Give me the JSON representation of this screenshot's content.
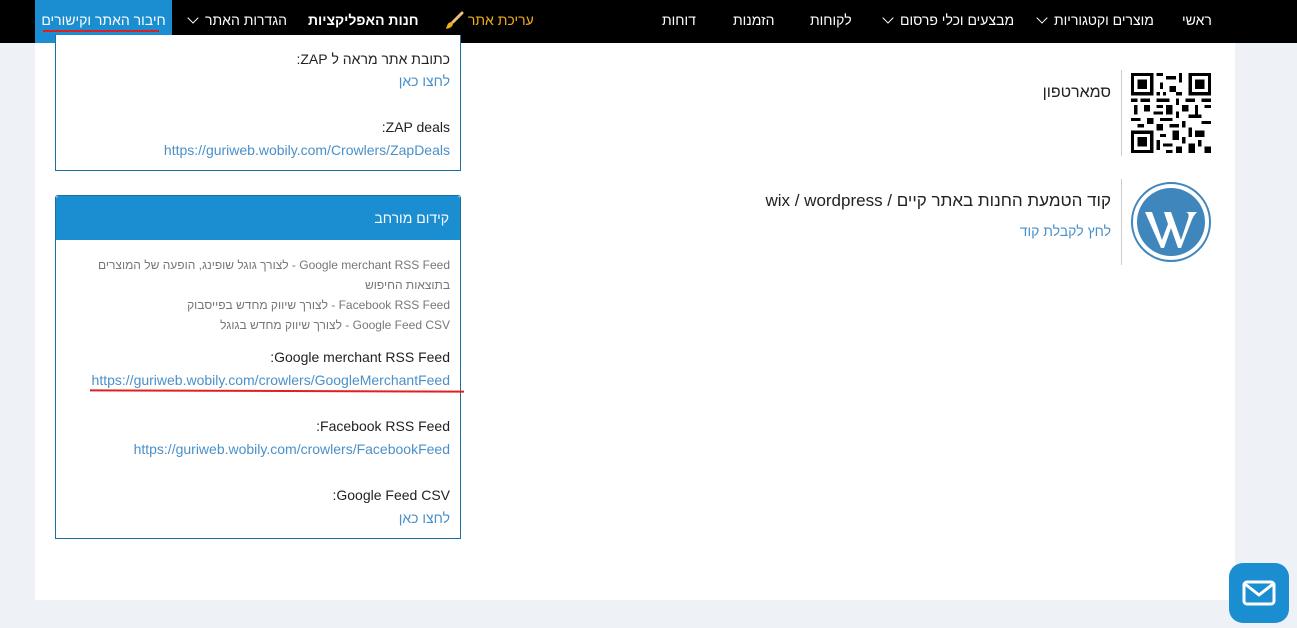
{
  "nav": {
    "home": "ראשי",
    "products": "מוצרים וקטגוריות",
    "promos": "מבצעים וכלי פרסום",
    "customers": "לקוחות",
    "orders": "הזמנות",
    "reports": "דוחות",
    "edit_site": "עריכת אתר",
    "app_store": "חנות האפליקציות",
    "site_settings": "הגדרות האתר",
    "site_connect": "חיבור האתר וקישורים"
  },
  "right": {
    "smartphone_label": "סמארטפון",
    "embed_title": "קוד הטמעת החנות באתר קיים / wix / wordpress",
    "embed_link": "לחץ לקבלת קוד"
  },
  "box1": {
    "zap_address_label": "כתובת אתר מראה ל ZAP:",
    "zap_address_link": "לחצו כאן",
    "zap_deals_label": "ZAP deals:",
    "zap_deals_link": "https://guriweb.wobily.com/Crowlers/ZapDeals"
  },
  "box2": {
    "header": "קידום מורחב",
    "desc_line1": "Google merchant RSS Feed - לצורך גוגל שופינג, הופעה של המוצרים",
    "desc_line2": "בתוצאות החיפוש",
    "desc_line3": "Facebook RSS Feed - לצורך שיווק מחדש בפייסבוק",
    "desc_line4": "Google Feed CSV - לצורך שיווק מחדש בגוגל",
    "gm_label": "Google merchant RSS Feed:",
    "gm_link": "https://guriweb.wobily.com/crowlers/GoogleMerchantFeed",
    "fb_label": "Facebook RSS Feed:",
    "fb_link": "https://guriweb.wobily.com/crowlers/FacebookFeed",
    "gcsv_label": "Google Feed CSV:",
    "gcsv_link": "לחצו כאן"
  }
}
